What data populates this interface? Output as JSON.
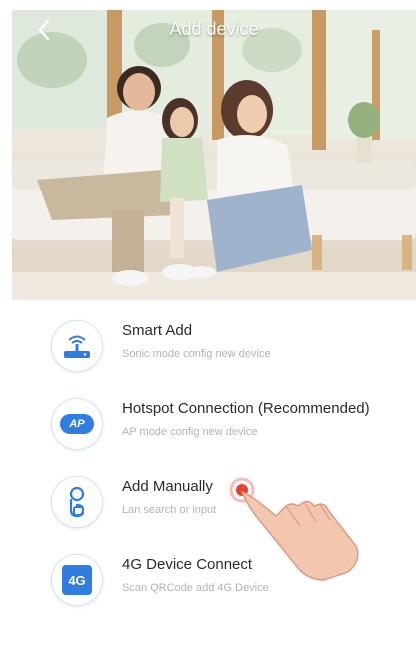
{
  "header": {
    "title": "Add device",
    "back_icon": "chevron-left-icon"
  },
  "hero_image": {
    "subject": "family-photo"
  },
  "options": [
    {
      "id": "smart-add",
      "icon": "wifi-router-icon",
      "title": "Smart Add",
      "subtitle": "Sonic mode config new device"
    },
    {
      "id": "hotspot-connection",
      "icon": "ap-icon",
      "icon_text": "AP",
      "title": "Hotspot Connection (Recommended)",
      "subtitle": "AP mode config new device"
    },
    {
      "id": "add-manually",
      "icon": "manual-add-icon",
      "title": "Add Manually",
      "subtitle": "Lan search or input"
    },
    {
      "id": "4g-device-connect",
      "icon": "4g-icon",
      "icon_text": "4G",
      "title": "4G Device Connect",
      "subtitle": "Scan QRCode add 4G Device"
    }
  ],
  "overlay": {
    "pointer_icon": "tap-hand-icon"
  },
  "colors": {
    "accent": "#2f7de1",
    "title_text": "#2a2a2a",
    "subtitle_text": "#b3b3b3",
    "tap_marker": "#e8402f"
  }
}
